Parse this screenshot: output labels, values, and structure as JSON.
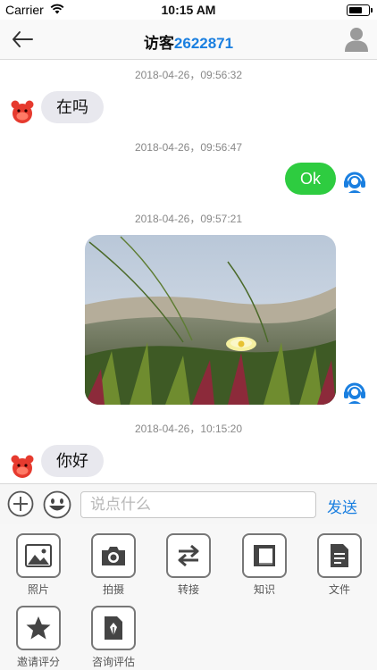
{
  "status_bar": {
    "carrier": "Carrier",
    "time": "10:15 AM"
  },
  "header": {
    "title_prefix": "访客",
    "visitor_id": "2622871"
  },
  "messages": [
    {
      "timestamp": "2018-04-26，09:56:32",
      "side": "left",
      "text": "在吗"
    },
    {
      "timestamp": "2018-04-26，09:56:47",
      "side": "right",
      "text": "Ok"
    },
    {
      "timestamp": "2018-04-26，09:57:21",
      "side": "right",
      "type": "image",
      "image_desc": "photo"
    },
    {
      "timestamp": "2018-04-26，10:15:20",
      "side": "left",
      "text": "你好"
    }
  ],
  "input_bar": {
    "placeholder": "说点什么",
    "value": "",
    "send_label": "发送"
  },
  "tools": [
    {
      "label": "照片",
      "icon": "photo-icon"
    },
    {
      "label": "拍摄",
      "icon": "camera-icon"
    },
    {
      "label": "转接",
      "icon": "transfer-icon"
    },
    {
      "label": "知识",
      "icon": "knowledge-icon"
    },
    {
      "label": "文件",
      "icon": "file-icon"
    },
    {
      "label": "邀请评分",
      "icon": "star-icon"
    },
    {
      "label": "咨询评估",
      "icon": "evaluation-icon"
    }
  ],
  "colors": {
    "accent_blue": "#1a7fe0",
    "agent_bubble_green": "#2ecc40",
    "visitor_bubble_gray": "#e8e8ee",
    "visitor_avatar_red": "#e63a2e"
  }
}
